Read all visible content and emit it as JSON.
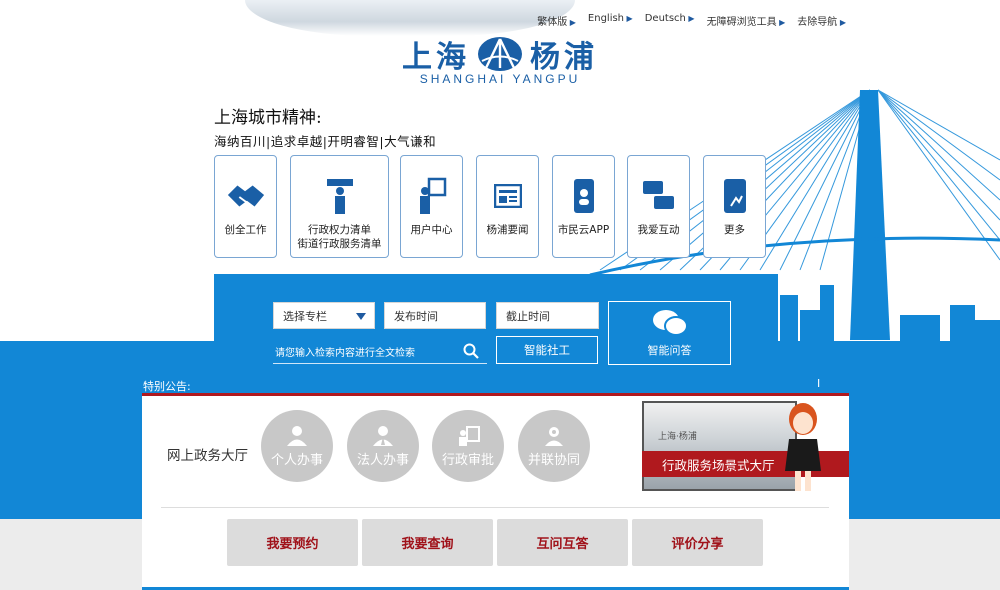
{
  "toplinks": [
    {
      "label": "繁体版"
    },
    {
      "label": "English"
    },
    {
      "label": "Deutsch"
    },
    {
      "label": "无障碍浏览工具"
    },
    {
      "label": "去除导航"
    }
  ],
  "logo": {
    "cn_left": "上海",
    "cn_right": "杨浦",
    "en": "SHANGHAI YANGPU"
  },
  "spirit": {
    "title": "上海城市精神:",
    "subtitle": "海纳百川|追求卓越|开明睿智|大气谦和"
  },
  "tiles": [
    {
      "label": "创全工作",
      "icon": "handshake-icon"
    },
    {
      "label": "行政权力清单\n街道行政服务清单",
      "icon": "person-board-icon"
    },
    {
      "label": "用户中心",
      "icon": "user-board-icon"
    },
    {
      "label": "杨浦要闻",
      "icon": "news-icon"
    },
    {
      "label": "市民云APP",
      "icon": "phone-icon"
    },
    {
      "label": "我爱互动",
      "icon": "chat-icon"
    },
    {
      "label": "更多",
      "icon": "tablet-icon"
    }
  ],
  "search": {
    "column_select": "选择专栏",
    "publish_time": "发布时间",
    "end_time": "截止时间",
    "fulltext_placeholder": "请您输入检索内容进行全文检索",
    "smart_social": "智能社工",
    "smart_qa": "智能问答"
  },
  "notice": {
    "label": "特别公告:",
    "marker": "I"
  },
  "services": {
    "title": "网上政务大厅",
    "circles": [
      {
        "label": "个人办事",
        "icon": "person-icon"
      },
      {
        "label": "法人办事",
        "icon": "corporate-person-icon"
      },
      {
        "label": "行政审批",
        "icon": "approval-icon"
      },
      {
        "label": "并联协同",
        "icon": "collaboration-icon"
      }
    ],
    "hall_label": "行政服务场景式大厅",
    "hall_sign": "上海·杨浦"
  },
  "actions": [
    {
      "label": "我要预约"
    },
    {
      "label": "我要查询"
    },
    {
      "label": "互问互答"
    },
    {
      "label": "评价分享"
    }
  ],
  "colors": {
    "brand_blue": "#1287d6",
    "accent_red": "#b0191e",
    "logo_blue": "#1a5fa6"
  }
}
